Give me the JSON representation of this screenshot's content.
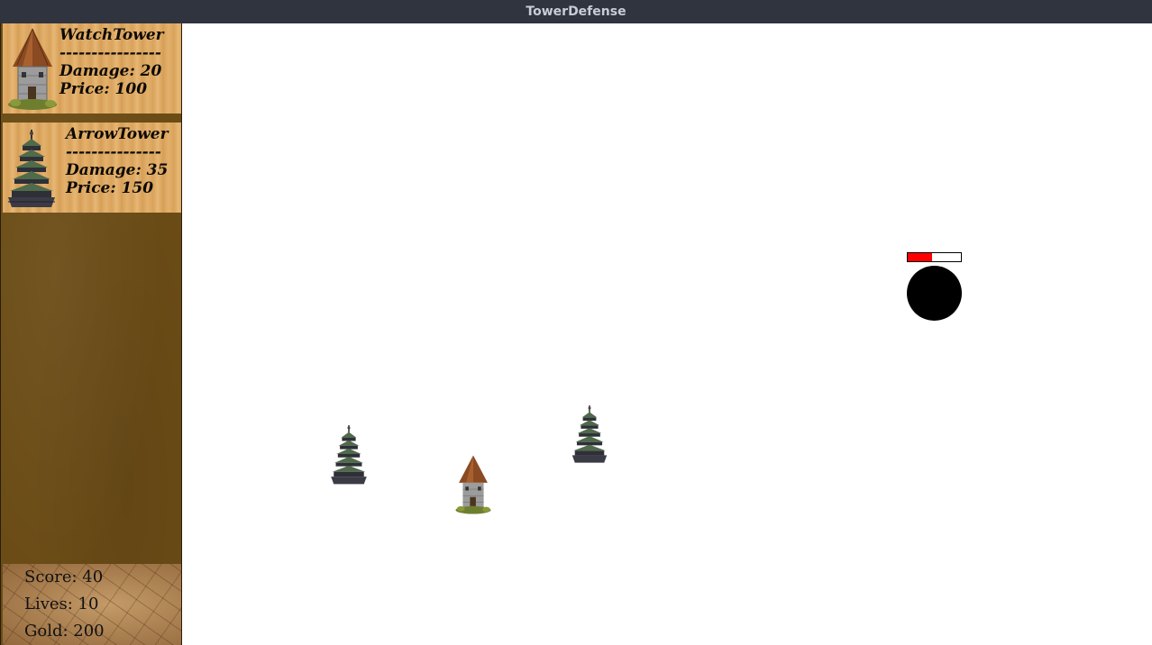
{
  "window": {
    "title": "TowerDefense"
  },
  "shop": [
    {
      "name": "WatchTower",
      "divider": "----------------",
      "damage": "Damage: 20",
      "price": "Price: 100",
      "icon": "watchtower-icon"
    },
    {
      "name": "ArrowTower",
      "divider": "---------------",
      "damage": "Damage: 35",
      "price": "Price: 150",
      "icon": "arrowtower-icon"
    }
  ],
  "stats": {
    "score": "Score: 40",
    "lives": "Lives: 10",
    "gold": "Gold: 200"
  },
  "game": {
    "placed_towers": [
      "arrowtower",
      "watchtower",
      "arrowtower"
    ],
    "enemy": {
      "health_fraction": 0.45,
      "health_color": "#ff0000",
      "body_color": "#000000"
    }
  },
  "colors": {
    "titlebar": "#2f343f",
    "sidebar": "#6b4c16",
    "card_wood": "#e2b06c"
  }
}
